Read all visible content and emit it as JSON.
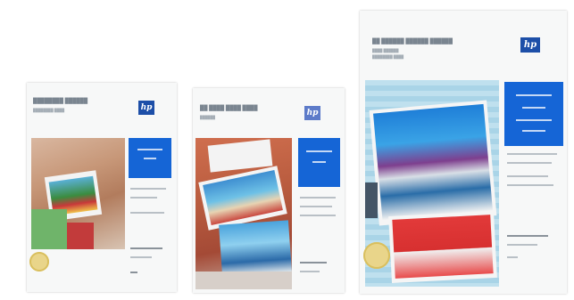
{
  "colors": {
    "brand_blue": "#1d4fa8",
    "panel_blue": "#1565d6",
    "package_white": "#f7f8f8",
    "seal_gold": "#e9d58a"
  },
  "packages": [
    {
      "name": "hp-photo-paper-package-small",
      "title": "",
      "logo": "hp"
    },
    {
      "name": "hp-photo-paper-package-medium",
      "title": "",
      "logo": "hp"
    },
    {
      "name": "hp-photo-paper-package-large",
      "title": "",
      "logo": "hp"
    }
  ]
}
